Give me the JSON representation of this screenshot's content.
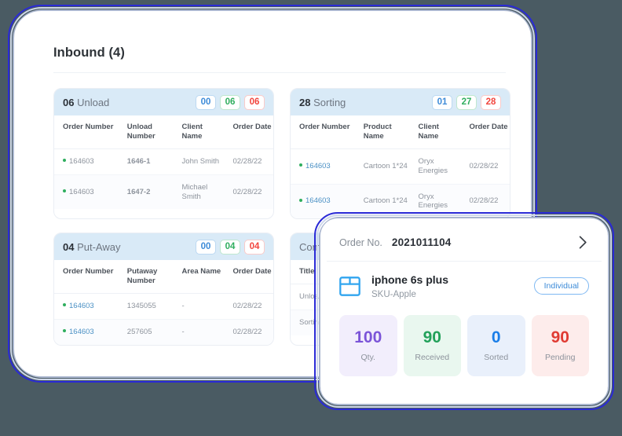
{
  "header": {
    "title": "Inbound (4)"
  },
  "cards": [
    {
      "number": "06",
      "name": "Unload",
      "badges": [
        {
          "value": "00",
          "color": "#3d8bd8"
        },
        {
          "value": "06",
          "color": "#2fae5e"
        },
        {
          "value": "06",
          "color": "#f2453d"
        }
      ],
      "columns": [
        "Order Number",
        "Unload Number",
        "Client Name",
        "Order Date"
      ],
      "rows": [
        {
          "order": "164603",
          "col2": "1646-1",
          "col3": "John Smith",
          "col4": "02/28/22"
        },
        {
          "order": "164603",
          "col2": "1647-2",
          "col3": "Michael Smith",
          "col4": "02/28/22"
        }
      ]
    },
    {
      "number": "28",
      "name": "Sorting",
      "badges": [
        {
          "value": "01",
          "color": "#3d8bd8"
        },
        {
          "value": "27",
          "color": "#2fae5e"
        },
        {
          "value": "28",
          "color": "#f2453d"
        }
      ],
      "columns": [
        "Order Number",
        "Product Name",
        "Client Name",
        "Order Date"
      ],
      "rows": [
        {
          "order": "164603",
          "col2": "Cartoon 1*24",
          "col3": "Oryx Energies",
          "col4": "02/28/22"
        },
        {
          "order": "164603",
          "col2": "Cartoon 1*24",
          "col3": "Oryx Energies",
          "col4": "02/28/22"
        }
      ]
    },
    {
      "number": "04",
      "name": "Put-Away",
      "badges": [
        {
          "value": "00",
          "color": "#3d8bd8"
        },
        {
          "value": "04",
          "color": "#2fae5e"
        },
        {
          "value": "04",
          "color": "#f2453d"
        }
      ],
      "columns": [
        "Order Number",
        "Putaway Number",
        "Area Name",
        "Order Date"
      ],
      "rows": [
        {
          "order": "164603",
          "col2": "1345055",
          "col3": "-",
          "col4": "02/28/22"
        },
        {
          "order": "164603",
          "col2": "257605",
          "col3": "-",
          "col4": "02/28/22"
        }
      ]
    },
    {
      "number": "",
      "name": "Comple",
      "badges": [],
      "columns": [
        "Title",
        "",
        "",
        ""
      ],
      "rows": [
        {
          "order": "Unloading",
          "col2": "",
          "col3": "",
          "col4": ""
        },
        {
          "order": "Sorting H",
          "col2": "",
          "col3": "",
          "col4": ""
        }
      ]
    }
  ],
  "detail": {
    "order_no_label": "Order No.",
    "order_no_value": "2021011104",
    "chevron_icon": "chevron-right-icon",
    "box_icon": "package-box-icon",
    "product_name": "iphone 6s plus",
    "product_sku": "SKU-Apple",
    "type_badge": "Individual",
    "stats": [
      {
        "value": "100",
        "label": "Qty.",
        "color": "#7b54d8"
      },
      {
        "value": "90",
        "label": "Received",
        "color": "#22a15a"
      },
      {
        "value": "0",
        "label": "Sorted",
        "color": "#1a7ee8"
      },
      {
        "value": "90",
        "label": "Pending",
        "color": "#e03b33"
      }
    ]
  }
}
